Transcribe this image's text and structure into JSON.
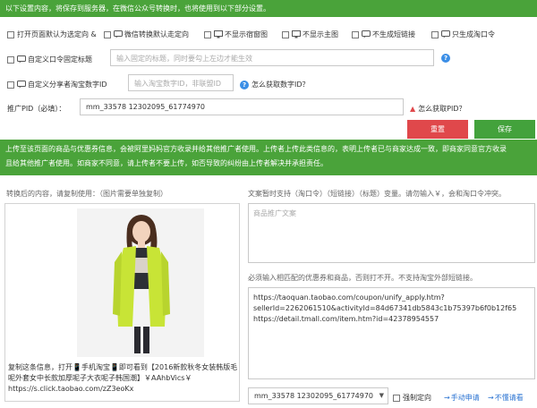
{
  "top_bar": {
    "text": "以下设置内容，将保存到服务器，在微信公众号转换时，也将使用到以下部分设置。"
  },
  "options_row1": [
    {
      "label": "打开页面默认为选定向 &",
      "icon": ""
    },
    {
      "label": "微信转换默认走定向",
      "icon": "chat-icon"
    },
    {
      "label": "不显示宿窗图",
      "icon": "monitor-icon"
    },
    {
      "label": "不显示主图",
      "icon": "monitor-icon"
    },
    {
      "label": "不生成短链接",
      "icon": "chat-icon"
    },
    {
      "label": "只生成淘口令",
      "icon": "chat-icon"
    }
  ],
  "custom_title": {
    "label": "自定义口令固定标题",
    "placeholder": "输入固定的标题，同时要勾上左边才能生效"
  },
  "custom_id": {
    "label": "自定义分享者淘宝数字ID",
    "placeholder": "输入淘宝数字ID，非联盟ID",
    "how_link": "怎么获取数字ID？"
  },
  "pid": {
    "label": "推广PID（必填）：",
    "value": "mm_33578      12302095_61774970",
    "how_link": "怎么获取PID？"
  },
  "buttons": {
    "reset": "重置",
    "save": "保存"
  },
  "notice": {
    "line1": "上传至该页面的商品与优惠券信息，会被阿里妈妈官方收录并给其他推广者使用。上传者上传此类信息的，表明上传者已与商家达成一致，即商家同意官方收录",
    "line2": "且给其他推广者使用。如商家不同意，请上传者不要上传，如否导致的纠纷由上传者解决并承担责任。"
  },
  "left_panel": {
    "label": "转换后的内容，请复制使用：（图片需要单独复制）",
    "caption_pre": "复制这条信息，打开📱手机淘宝📱即可看到【2016新款秋冬女装韩版毛呢外套女中长款加厚呢子大衣呢子韩国潮】￥AAhbVics￥",
    "caption_url": "https://s.click.taobao.com/zZ3eoKx"
  },
  "right_panel": {
    "label_copy": "文案暂时支持（淘口令）（短链接）（标题）变量。请勿输入￥，会和淘口令冲突。",
    "copy_placeholder": "商品推广文案",
    "label_match": "必须输入相匹配的优惠券和商品，否则打不开。不支持淘宝外部短链接。",
    "urls_line1": "https://taoquan.taobao.com/coupon/unify_apply.htm?",
    "urls_line2": "sellerId=2262061510&activityId=84d67341db5843c1b75397b6f0b12f65",
    "urls_line3": "https://detail.tmall.com/item.htm?id=42378954557",
    "pid_select": "mm_33578      12302095_61774970",
    "force_label": "强制定向",
    "manual_link": "手动申请",
    "nodouble_link": "不懂请看"
  },
  "colors": {
    "green": "#4aa33a",
    "red": "#e0484b",
    "link": "#2a73d2"
  }
}
